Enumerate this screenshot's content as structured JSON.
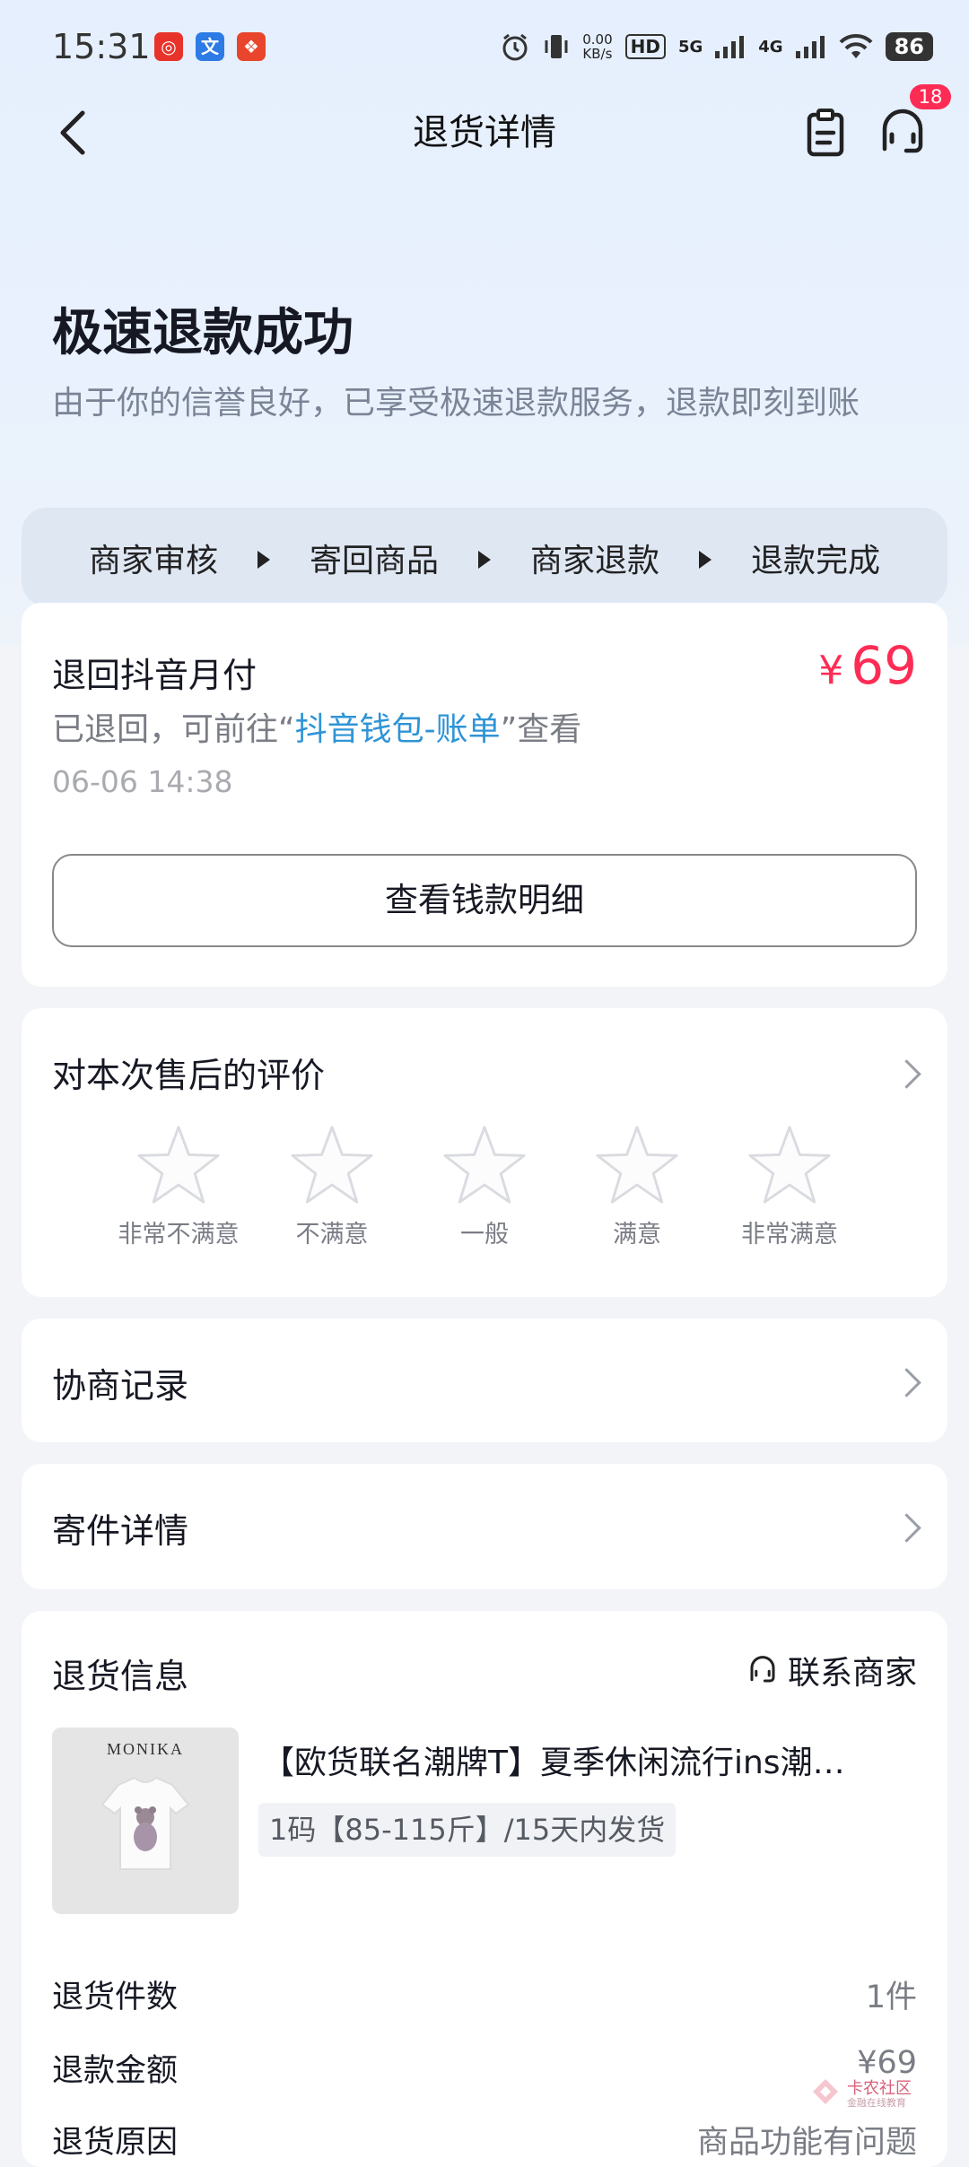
{
  "status_bar": {
    "time": "15:31",
    "net_speed_value": "0.00",
    "net_speed_unit": "KB/s",
    "hd_label": "HD",
    "sim1_label": "5G",
    "sim2_label": "4G",
    "battery": "86"
  },
  "header": {
    "title": "退货详情",
    "message_badge": "18"
  },
  "hero": {
    "title": "极速退款成功",
    "subtitle": "由于你的信誉良好，已享受极速退款服务，退款即刻到账"
  },
  "steps": [
    "商家审核",
    "寄回商品",
    "商家退款",
    "退款完成"
  ],
  "refund": {
    "title": "退回抖音月付",
    "currency": "¥",
    "amount": "69",
    "desc_prefix": "已退回，可前往“",
    "desc_link": "抖音钱包-账单",
    "desc_suffix": "”查看",
    "time": "06-06 14:38",
    "detail_button": "查看钱款明细"
  },
  "rating": {
    "title": "对本次售后的评价",
    "options": [
      "非常不满意",
      "不满意",
      "一般",
      "满意",
      "非常满意"
    ],
    "selected_stars": 0
  },
  "negotiation": {
    "title": "协商记录"
  },
  "shipping": {
    "title": "寄件详情"
  },
  "return_info": {
    "title": "退货信息",
    "contact_label": "联系商家",
    "product": {
      "thumb_brand": "MONIKA",
      "name": "【欧货联名潮牌T】夏季休闲流行ins潮…",
      "spec": "1码【85-115斤】/15天内发货"
    },
    "rows": [
      {
        "label": "退货件数",
        "value": "1件"
      },
      {
        "label": "退款金额",
        "value": "¥69"
      },
      {
        "label": "退货原因",
        "value": "商品功能有问题"
      }
    ]
  },
  "watermark": {
    "text": "卡农社区",
    "sub": "金融在线教育"
  },
  "colors": {
    "accent_red": "#fe2c55",
    "link_blue": "#2f94d6"
  }
}
